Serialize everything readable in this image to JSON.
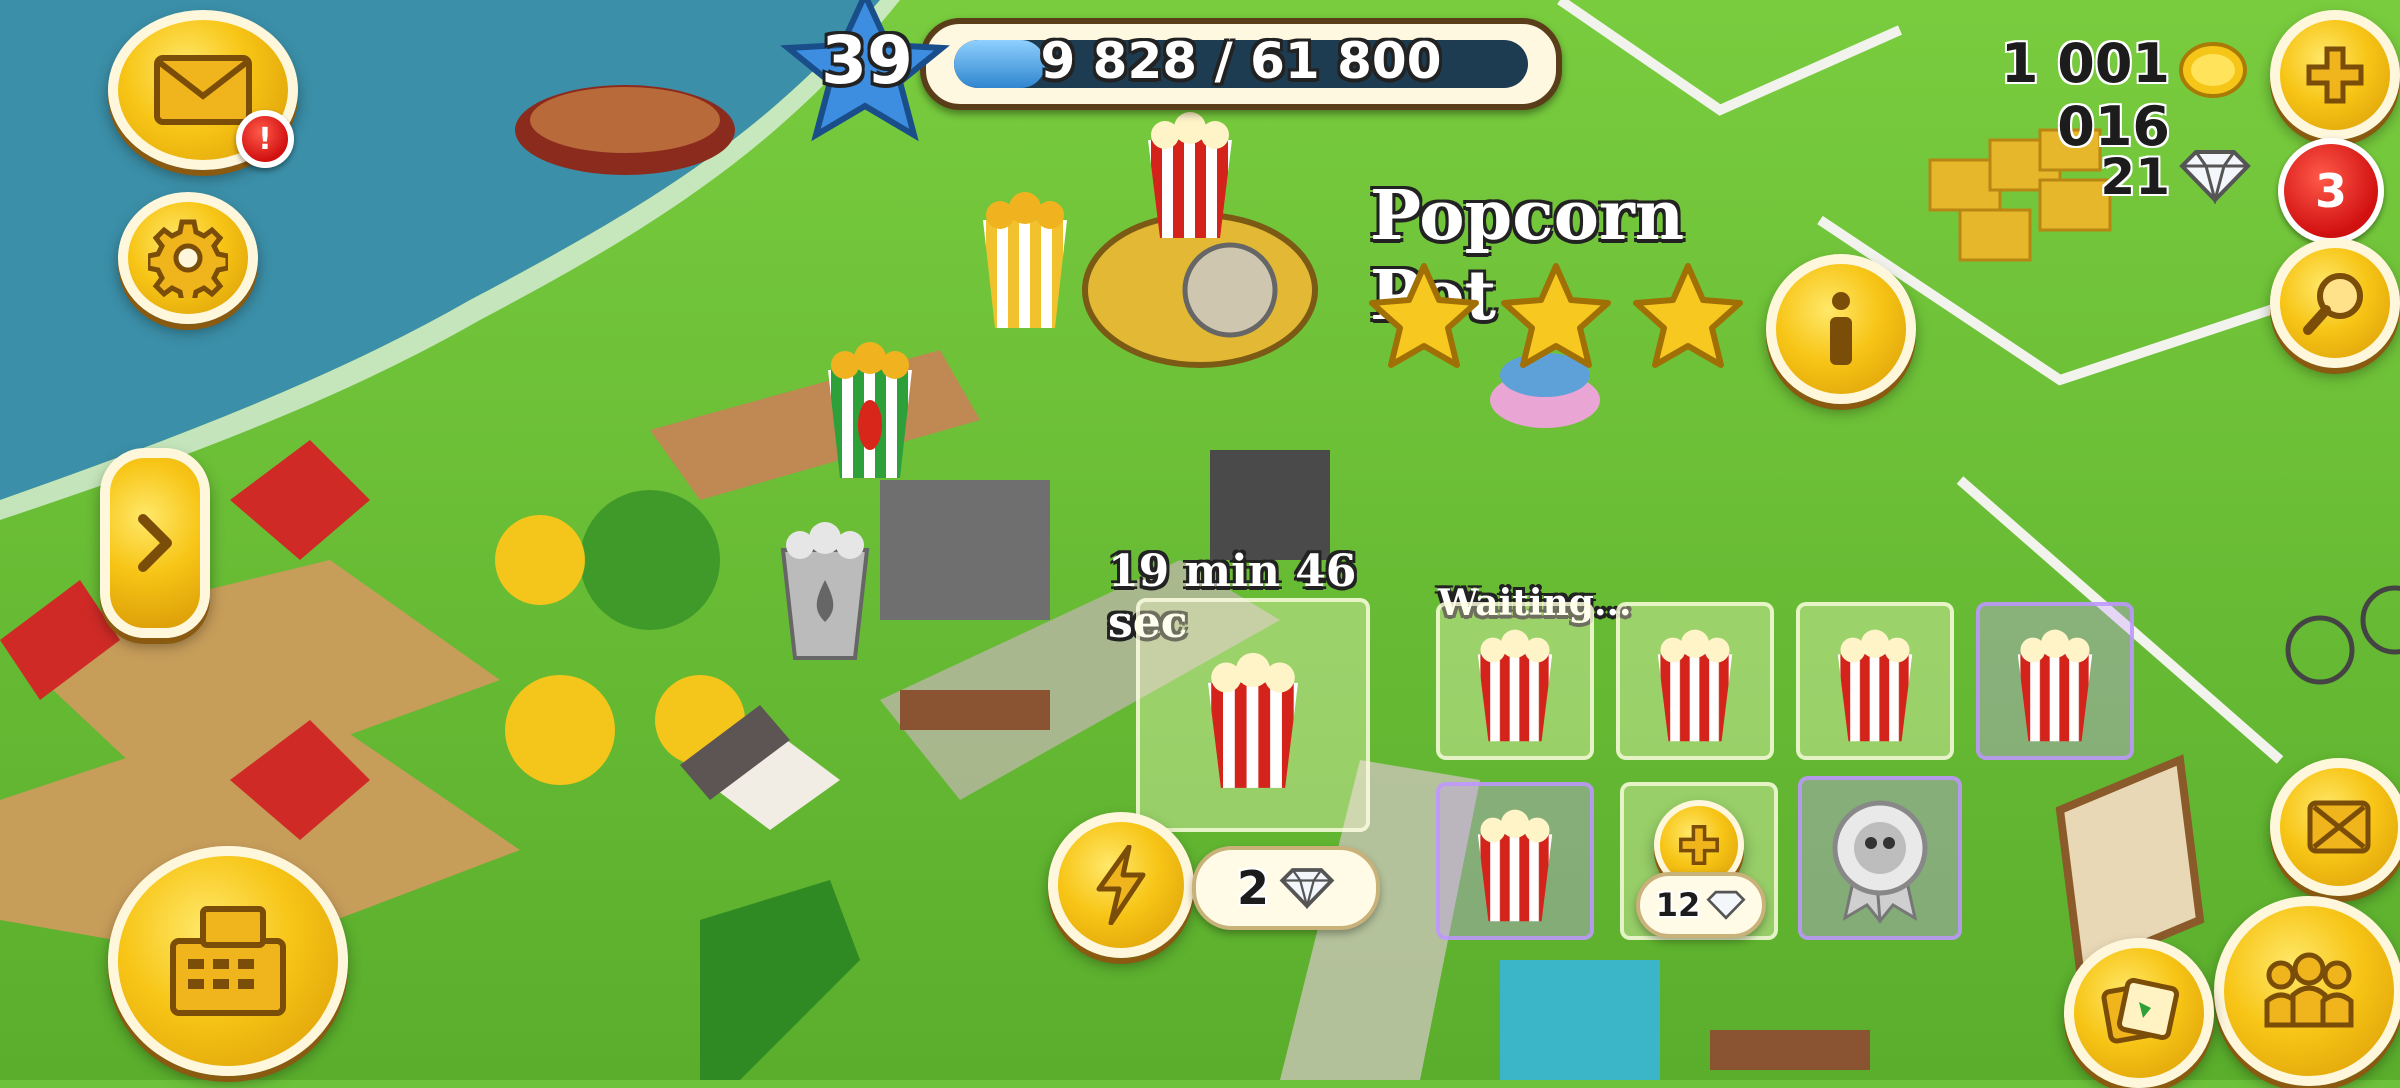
{
  "hud": {
    "level": "39",
    "xp_text": "9 828 / 61 800",
    "xp_progress": 0.159,
    "coins": "1 001 016",
    "diamonds": "21",
    "notification_count": "3",
    "mail_alert": "!"
  },
  "production": {
    "machine_name": "Popcorn Pot",
    "stars": 3,
    "timer": "19 min 46 sec",
    "waiting_label": "Waiting...",
    "skip_cost": "2",
    "unlock_slot_cost": "12"
  },
  "colors": {
    "water": "#3b8fa8",
    "grass": "#6cc23a",
    "button_gold": "#f7c516",
    "badge_red": "#d11010",
    "xp_bar": "#4aa3e0"
  },
  "icons": {
    "mail": "envelope-icon",
    "settings": "gear-icon",
    "expand": "chevron-right-icon",
    "shop": "cash-register-icon",
    "add": "plus-icon",
    "search": "magnifier-icon",
    "info": "info-icon",
    "speed": "lightning-icon",
    "map": "map-expand-icon",
    "friends": "friends-icon",
    "cards": "cards-icon"
  }
}
